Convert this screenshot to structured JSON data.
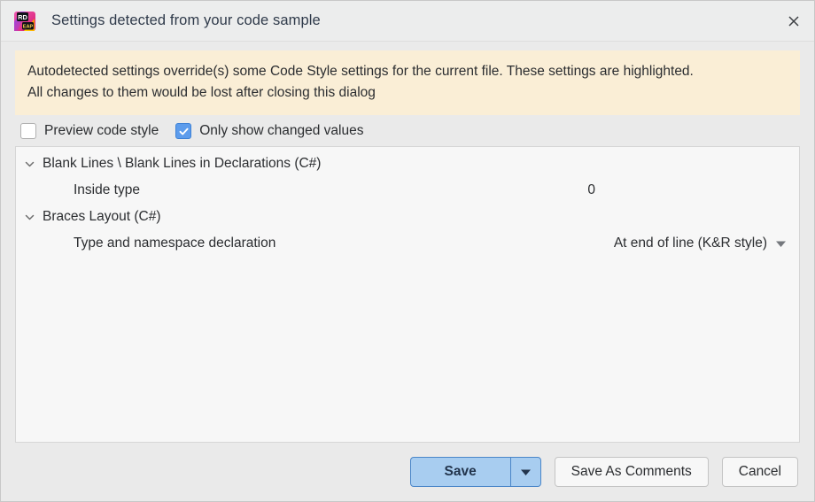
{
  "window": {
    "title": "Settings detected from your code sample",
    "app_icon": "rider-eap-icon",
    "app_icon_text_top": "RD",
    "app_icon_text_bottom": "EAP",
    "close_icon": "close-icon"
  },
  "banner": {
    "line1": "Autodetected settings override(s) some Code Style settings for the current file. These settings are highlighted.",
    "line2": "All changes to them would be lost after closing this dialog",
    "background": "#faeed6"
  },
  "options": [
    {
      "label": "Preview code style",
      "checked": false,
      "name": "preview-code-style"
    },
    {
      "label": "Only show changed values",
      "checked": true,
      "name": "only-show-changed-values"
    }
  ],
  "tree": {
    "groups": [
      {
        "label": "Blank Lines \\ Blank Lines in Declarations (C#)",
        "expanded": true,
        "children": [
          {
            "label": "Inside type",
            "value": "0",
            "control": "text"
          }
        ]
      },
      {
        "label": "Braces Layout (C#)",
        "expanded": true,
        "children": [
          {
            "label": "Type and namespace declaration",
            "value": "At end of line (K&R style)",
            "control": "dropdown"
          }
        ]
      }
    ]
  },
  "footer": {
    "save_label": "Save",
    "save_dropdown_icon": "chevron-down-icon",
    "save_as_comments_label": "Save As Comments",
    "cancel_label": "Cancel"
  },
  "colors": {
    "accent_blue": "#a8cdf0",
    "accent_blue_border": "#4a86c8",
    "checkbox_blue": "#5d9cec",
    "banner_bg": "#faeed6",
    "dialog_bg": "#eaeaea",
    "panel_bg": "#f7f7f7"
  }
}
